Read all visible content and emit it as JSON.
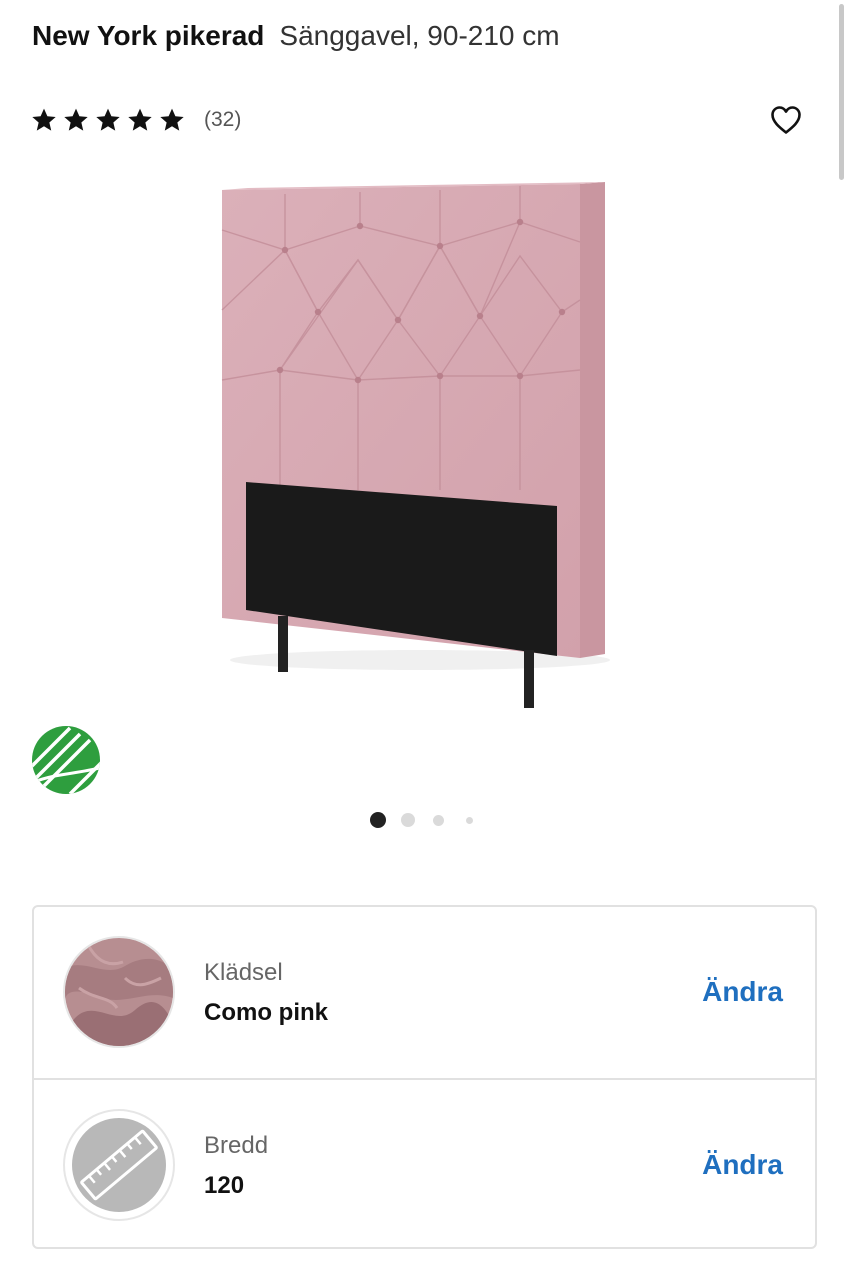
{
  "product": {
    "name": "New York pikerad",
    "description": "Sänggavel, 90-210 cm",
    "review_count": "(32)",
    "rating_stars": 5
  },
  "icons": {
    "favorite": "heart-outline-icon",
    "eco_label": "nordic-swan-ecolabel-icon",
    "width_option": "ruler-icon"
  },
  "carousel": {
    "total": 4,
    "active": 1
  },
  "options": [
    {
      "label": "Klädsel",
      "value": "Como pink",
      "action": "Ändra"
    },
    {
      "label": "Bredd",
      "value": "120",
      "action": "Ändra"
    }
  ],
  "colors": {
    "link": "#1f6fbf",
    "upholstery": "#d7a7b1",
    "eco_green": "#2e9e3e"
  }
}
